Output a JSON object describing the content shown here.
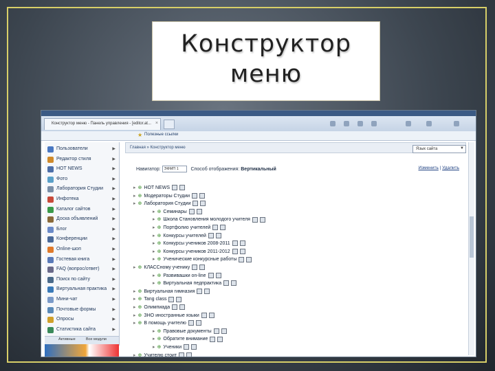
{
  "slide": {
    "title_line1": "Конструктор",
    "title_line2": "меню"
  },
  "browser": {
    "tab_title": "Конструктор меню - Панель управления - [editor.at...",
    "tab_close": "×",
    "bookmarks_label": "Полезные ссылки"
  },
  "sidebar": {
    "items": [
      {
        "label": "Пользователи",
        "icon": "users-icon",
        "color": "#4a78c2"
      },
      {
        "label": "Редактор стиля",
        "icon": "palette-icon",
        "color": "#d08a2a"
      },
      {
        "label": "HOT NEWS",
        "icon": "news-icon",
        "color": "#4d6fa8"
      },
      {
        "label": "Фото",
        "icon": "photo-icon",
        "color": "#5aa0c8"
      },
      {
        "label": "Лаборатория Студии",
        "icon": "lab-icon",
        "color": "#7a8fa8"
      },
      {
        "label": "Инфотека",
        "icon": "book-icon",
        "color": "#c84a3a"
      },
      {
        "label": "Каталог сайтов",
        "icon": "globe-icon",
        "color": "#3a9a4a"
      },
      {
        "label": "Доска объявлений",
        "icon": "board-icon",
        "color": "#8a6a3a"
      },
      {
        "label": "Блог",
        "icon": "blog-icon",
        "color": "#6a8ac8"
      },
      {
        "label": "Конференции",
        "icon": "conference-icon",
        "color": "#4a6a9a"
      },
      {
        "label": "Online-шоп",
        "icon": "shop-icon",
        "color": "#e07a2a"
      },
      {
        "label": "Гостевая книга",
        "icon": "guestbook-icon",
        "color": "#5a7ab8"
      },
      {
        "label": "FAQ (вопрос/ответ)",
        "icon": "faq-icon",
        "color": "#6a6a8a"
      },
      {
        "label": "Поиск по сайту",
        "icon": "search-icon",
        "color": "#4a6a8a"
      },
      {
        "label": "Виртуальная практика",
        "icon": "practice-icon",
        "color": "#3a7ab8"
      },
      {
        "label": "Мини-чат",
        "icon": "chat-icon",
        "color": "#7a9ac8"
      },
      {
        "label": "Почтовые формы",
        "icon": "mail-icon",
        "color": "#5a8ab8"
      },
      {
        "label": "Опросы",
        "icon": "poll-icon",
        "color": "#d0a02a"
      },
      {
        "label": "Статистика сайта",
        "icon": "stats-icon",
        "color": "#3a8a5a"
      }
    ],
    "arrow": "▶",
    "tabs": [
      "Активные",
      "Все модули"
    ]
  },
  "content": {
    "breadcrumb": "Главная » Конструктор меню",
    "language_select": "Язык сайта",
    "language_arrow": "▼",
    "nav_label": "Навигатор:",
    "nav_value": "ЭФМП 1",
    "display_label": "Способ отображения:",
    "display_value": "Вертикальный",
    "link_change": "Изменить",
    "link_sep": "|",
    "link_delete": "Удалить",
    "tree": [
      {
        "label": "HOT NEWS",
        "level": 0,
        "sub": false
      },
      {
        "label": "Модераторы Студии",
        "level": 0,
        "sub": false
      },
      {
        "label": "Лаборатория Студии",
        "level": 0,
        "sub": false
      },
      {
        "label": "Семинары",
        "level": 1,
        "sub": true
      },
      {
        "label": "Школа Становления молодого учителя",
        "level": 1,
        "sub": true
      },
      {
        "label": "Портфолио учителей",
        "level": 1,
        "sub": true
      },
      {
        "label": "Конкурсы учителей",
        "level": 1,
        "sub": true
      },
      {
        "label": "Конкурсы учеников 2008-2011",
        "level": 1,
        "sub": true
      },
      {
        "label": "Конкурсы учеников 2011-2012",
        "level": 1,
        "sub": true
      },
      {
        "label": "Ученические конкурсные работы",
        "level": 1,
        "sub": true
      },
      {
        "label": "КЛАССному ученику",
        "level": 0,
        "sub": false
      },
      {
        "label": "Развивашки on-line",
        "level": 1,
        "sub": true
      },
      {
        "label": "Виртуальная педпрактика",
        "level": 1,
        "sub": true
      },
      {
        "label": "Виртуальная гимназия",
        "level": 0,
        "sub": false
      },
      {
        "label": "Tang class",
        "level": 0,
        "sub": false
      },
      {
        "label": "Олимпиада",
        "level": 0,
        "sub": false
      },
      {
        "label": "ЗНО иностранные языки",
        "level": 0,
        "sub": false
      },
      {
        "label": "В помощь учителю",
        "level": 0,
        "sub": false
      },
      {
        "label": "Правовые документы",
        "level": 1,
        "sub": true
      },
      {
        "label": "Обратите внимание",
        "level": 1,
        "sub": true
      },
      {
        "label": "Ученики",
        "level": 1,
        "sub": true
      },
      {
        "label": "Учителю стоит",
        "level": 0,
        "sub": false
      }
    ],
    "expander": "▸",
    "bullet": "⊕"
  }
}
